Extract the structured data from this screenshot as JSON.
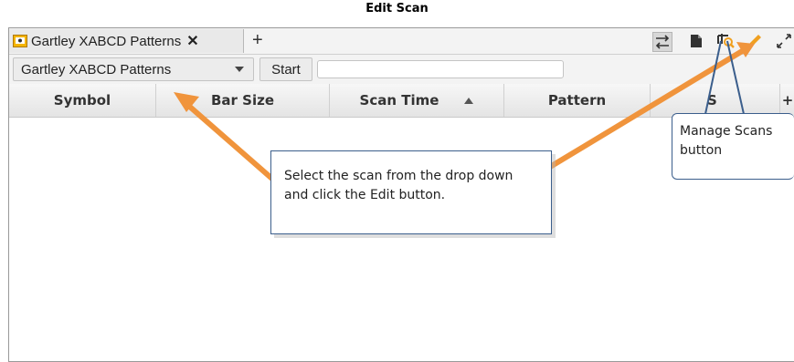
{
  "page_title": "Edit Scan",
  "tab": {
    "label": "Gartley XABCD Patterns",
    "close": "✕",
    "add": "+"
  },
  "toolbar": {
    "icons": [
      "sync-arrows-icon",
      "document-icon",
      "manage-scans-icon",
      "pencil-edit-icon",
      "expand-icon"
    ],
    "edit_color": "#f0a020"
  },
  "scan_row": {
    "selected_scan": "Gartley XABCD Patterns",
    "start_label": "Start",
    "input_value": ""
  },
  "columns": [
    {
      "label": "Symbol"
    },
    {
      "label": "Bar Size"
    },
    {
      "label": "Scan Time",
      "sort": "ascending"
    },
    {
      "label": "Pattern"
    },
    {
      "label": "S"
    },
    {
      "label": "+"
    }
  ],
  "annotations": {
    "main_callout": "Select the scan from the drop down and click the Edit button.",
    "manage_callout": "Manage Scans button",
    "arrow_color": "#f0943c",
    "callout_border": "#3b5e8c"
  }
}
